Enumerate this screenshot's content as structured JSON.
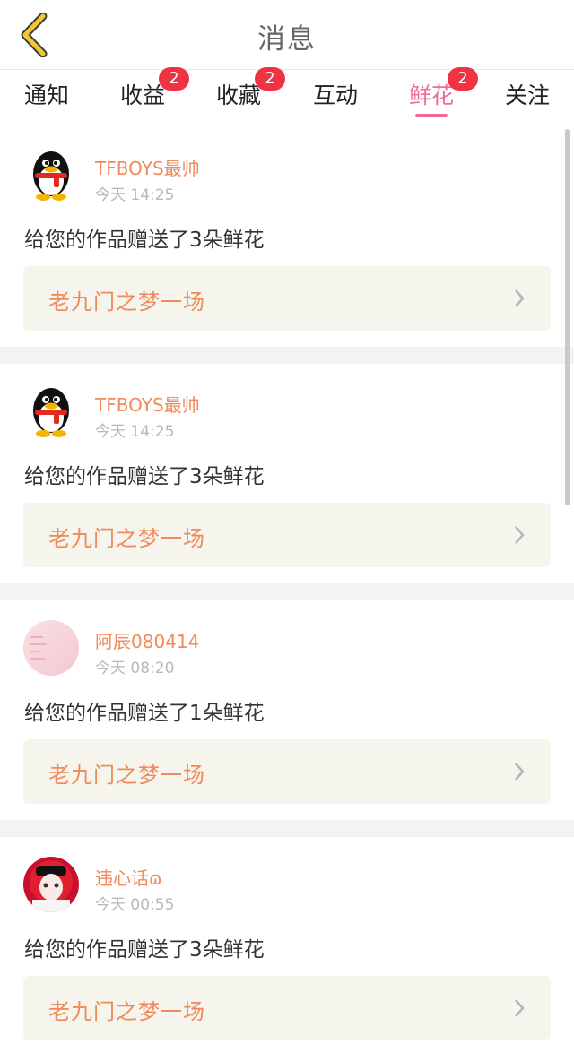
{
  "header": {
    "title": "消息"
  },
  "tabs": [
    {
      "label": "通知",
      "badge": ""
    },
    {
      "label": "收益",
      "badge": "2"
    },
    {
      "label": "收藏",
      "badge": "2"
    },
    {
      "label": "互动",
      "badge": ""
    },
    {
      "label": "鲜花",
      "badge": "2",
      "active": true
    },
    {
      "label": "关注",
      "badge": ""
    }
  ],
  "messages": [
    {
      "name": "TFBOYS最帅",
      "time": "今天 14:25",
      "text": "给您的作品赠送了3朵鲜花",
      "work": "老九门之梦一场",
      "avatar": "penguin-avatar"
    },
    {
      "name": "TFBOYS最帅",
      "time": "今天 14:25",
      "text": "给您的作品赠送了3朵鲜花",
      "work": "老九门之梦一场",
      "avatar": "penguin-avatar"
    },
    {
      "name": "阿辰080414",
      "time": "今天 08:20",
      "text": "给您的作品赠送了1朵鲜花",
      "work": "老九门之梦一场",
      "avatar": "pink-avatar"
    },
    {
      "name": "违心话ɷ",
      "time": "今天 00:55",
      "text": "给您的作品赠送了3朵鲜花",
      "work": "老九门之梦一场",
      "avatar": "red-character-avatar"
    }
  ],
  "colors": {
    "accent": "#ee6a9c",
    "name": "#ef8a5a",
    "badge": "#ee3344"
  }
}
